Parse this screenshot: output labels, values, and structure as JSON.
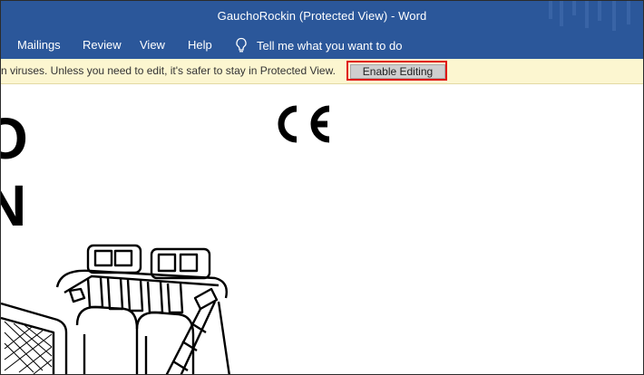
{
  "window": {
    "title": "GauchoRockin (Protected View)  -  Word"
  },
  "ribbon": {
    "tabs": [
      {
        "label": "Mailings"
      },
      {
        "label": "Review"
      },
      {
        "label": "View"
      },
      {
        "label": "Help"
      }
    ],
    "tell_me": "Tell me what you want to do"
  },
  "protected_view": {
    "message": "n viruses. Unless you need to edit, it's safer to stay in Protected View.",
    "button_label": "Enable Editing",
    "highlight_color": "#e01010"
  },
  "document": {
    "mark": "CE",
    "heading_partial": [
      "O",
      "N"
    ]
  },
  "colors": {
    "accent": "#2b579a",
    "infobar": "#fcf6d0"
  }
}
